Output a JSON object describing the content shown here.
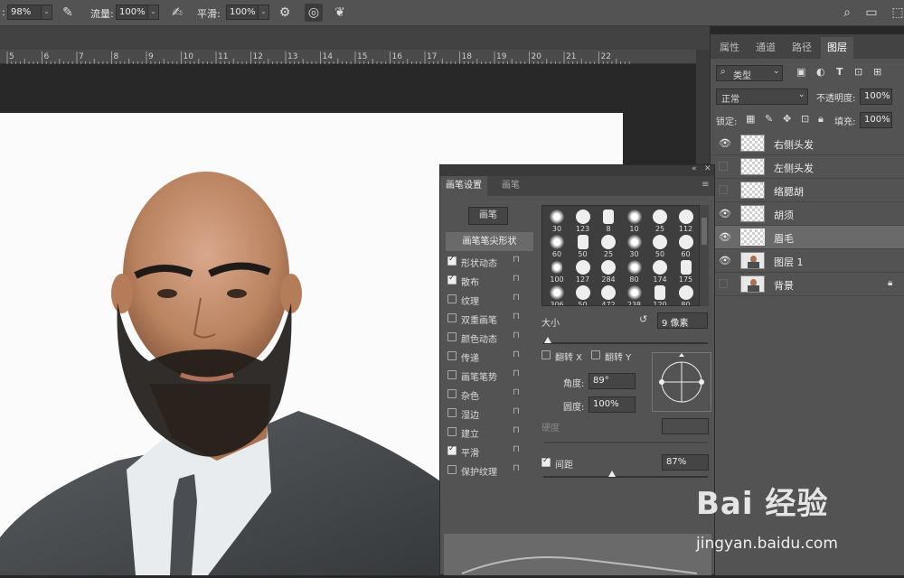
{
  "options_bar": {
    "opacity_value": "98%",
    "flow_label": "流量:",
    "flow_value": "100%",
    "smoothing_label": "平滑:",
    "smoothing_value": "100%"
  },
  "ruler": {
    "ticks": [
      "5",
      "6",
      "7",
      "8",
      "9",
      "10",
      "11",
      "12",
      "13",
      "14",
      "15",
      "16",
      "17",
      "18",
      "19",
      "20",
      "21",
      "22"
    ]
  },
  "right_panel": {
    "tabs": [
      "属性",
      "通道",
      "路径",
      "图层"
    ],
    "filter_label": "类型",
    "blend_mode": "正常",
    "opacity_label": "不透明度:",
    "opacity_value": "100%",
    "lock_label": "锁定:",
    "fill_label": "填充:",
    "fill_value": "100%",
    "layers": [
      {
        "name": "右侧头发",
        "visible": true
      },
      {
        "name": "左侧头发",
        "visible": false
      },
      {
        "name": "络腮胡",
        "visible": false
      },
      {
        "name": "胡须",
        "visible": true
      },
      {
        "name": "眉毛",
        "visible": true
      },
      {
        "name": "图层 1",
        "visible": true
      },
      {
        "name": "背景",
        "visible": false
      }
    ]
  },
  "brush_panel": {
    "tabs": [
      "画笔设置",
      "画笔"
    ],
    "brush_button": "画笔",
    "tip_shape": "画笔笔尖形状",
    "options": [
      {
        "label": "形状动态",
        "checked": true
      },
      {
        "label": "散布",
        "checked": true
      },
      {
        "label": "纹理",
        "checked": false
      },
      {
        "label": "双重画笔",
        "checked": false
      },
      {
        "label": "颜色动态",
        "checked": false
      },
      {
        "label": "传递",
        "checked": false
      },
      {
        "label": "画笔笔势",
        "checked": false
      },
      {
        "label": "杂色",
        "checked": false
      },
      {
        "label": "湿边",
        "checked": false
      },
      {
        "label": "建立",
        "checked": false
      },
      {
        "label": "平滑",
        "checked": true
      },
      {
        "label": "保护纹理",
        "checked": false
      }
    ],
    "tip_sizes": [
      "30",
      "123",
      "8",
      "10",
      "25",
      "112",
      "60",
      "50",
      "25",
      "30",
      "50",
      "60",
      "100",
      "127",
      "284",
      "80",
      "174",
      "175",
      "306",
      "50",
      "472",
      "238",
      "120",
      "80"
    ],
    "size_label": "大小",
    "size_value": "9 像素",
    "flip_x": "翻转 X",
    "flip_y": "翻转 Y",
    "angle_label": "角度:",
    "angle_value": "89°",
    "roundness_label": "圆度:",
    "roundness_value": "100%",
    "hardness_label": "硬度",
    "spacing_label": "间距",
    "spacing_value": "87%"
  },
  "watermark": {
    "logo": "Bai 经验",
    "url": "jingyan.baidu.com"
  }
}
